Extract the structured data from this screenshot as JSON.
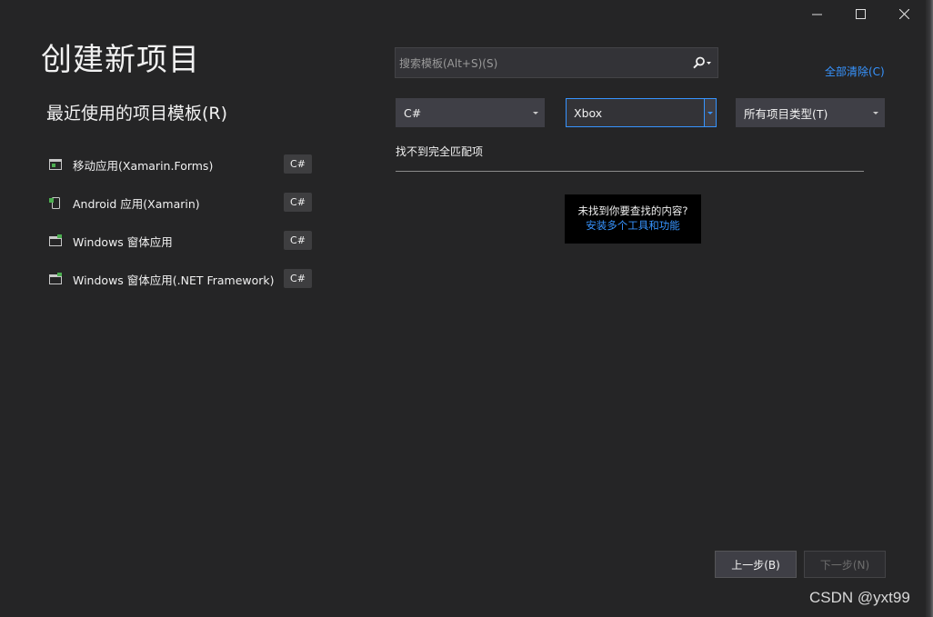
{
  "window": {
    "controls": {
      "minimize_icon": "minimize-icon",
      "maximize_icon": "maximize-icon",
      "close_icon": "close-icon"
    }
  },
  "page_title": "创建新项目",
  "recent": {
    "heading": "最近使用的项目模板(R)",
    "items": [
      {
        "label": "移动应用(Xamarin.Forms)",
        "lang": "C#",
        "icon": "mobile-app-icon"
      },
      {
        "label": "Android 应用(Xamarin)",
        "lang": "C#",
        "icon": "android-app-icon"
      },
      {
        "label": "Windows 窗体应用",
        "lang": "C#",
        "icon": "windows-form-icon"
      },
      {
        "label": "Windows 窗体应用(.NET Framework)",
        "lang": "C#",
        "icon": "windows-form-icon"
      }
    ]
  },
  "search": {
    "placeholder": "搜索模板(Alt+S)(S)",
    "value": "",
    "icon": "search-icon"
  },
  "clear_all": "全部清除(C)",
  "filters": {
    "language": "C#",
    "platform": "Xbox",
    "project_type": "所有项目类型(T)"
  },
  "results": {
    "no_match": "找不到完全匹配项",
    "not_found_prompt": "未找到你要查找的内容?",
    "install_link": "安装多个工具和功能"
  },
  "footer": {
    "back_label": "上一步(B)",
    "next_label": "下一步(N)"
  },
  "watermark": "CSDN @yxt99",
  "colors": {
    "background": "#252526",
    "accent": "#3794ff",
    "control": "#3f3f46"
  }
}
